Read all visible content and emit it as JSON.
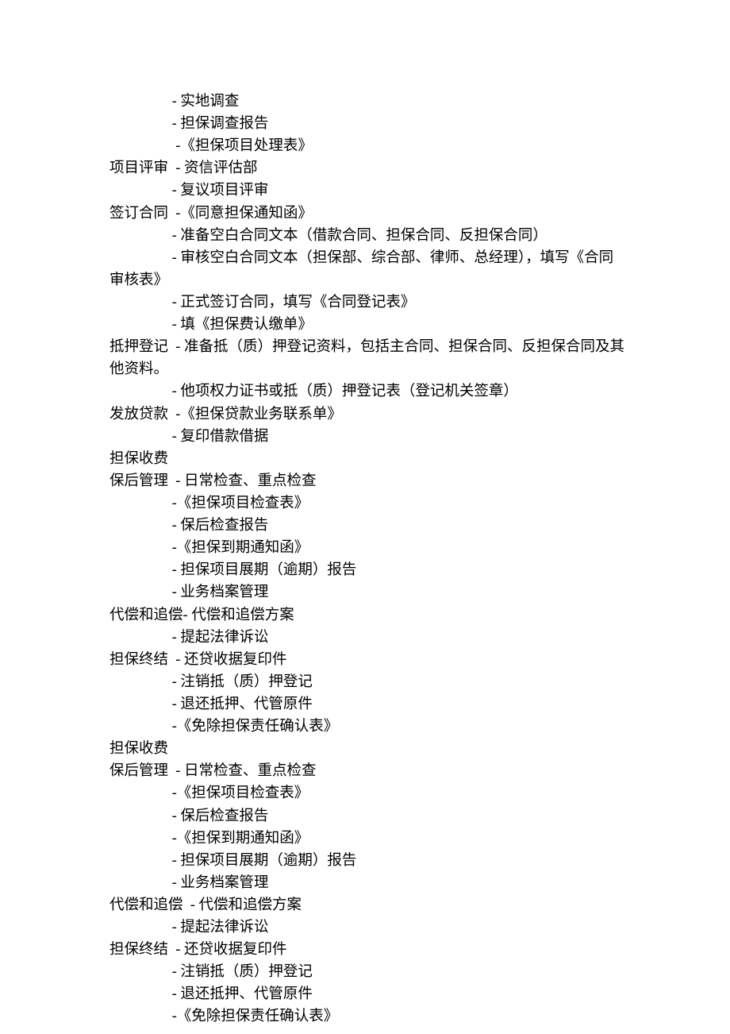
{
  "lines": [
    "                 - 实地调查",
    "                 - 担保调查报告",
    "                  -《担保项目处理表》",
    "项目评审  - 资信评估部",
    "                 - 复议项目评审",
    "签订合同  -《同意担保通知函》",
    "                 - 准备空白合同文本（借款合同、担保合同、反担保合同）",
    "                 - 审核空白合同文本（担保部、综合部、律师、总经理），填写《合同审核表》",
    "                 - 正式签订合同，填写《合同登记表》",
    "                 - 填《担保费认缴单》",
    "抵押登记  - 准备抵（质）押登记资料，包括主合同、担保合同、反担保合同及其他资料。",
    "                 - 他项权力证书或抵（质）押登记表（登记机关签章）",
    "发放贷款  -《担保贷款业务联系单》",
    "                 - 复印借款借据",
    "担保收费",
    "保后管理  - 日常检查、重点检查",
    "                 -《担保项目检查表》",
    "                 - 保后检查报告",
    "                 -《担保到期通知函》",
    "                 - 担保项目展期（逾期）报告",
    "                 - 业务档案管理",
    "代偿和追偿- 代偿和追偿方案",
    "                 - 提起法律诉讼",
    "担保终结  - 还贷收据复印件",
    "                 - 注销抵（质）押登记",
    "                 - 退还抵押、代管原件",
    "                 -《免除担保责任确认表》",
    "担保收费",
    "保后管理  - 日常检查、重点检查",
    "                 -《担保项目检查表》",
    "                 - 保后检查报告",
    "                 -《担保到期通知函》",
    "                 - 担保项目展期（逾期）报告",
    "                 - 业务档案管理",
    "代偿和追偿  - 代偿和追偿方案",
    "                 - 提起法律诉讼",
    "担保终结  - 还贷收据复印件",
    "                 - 注销抵（质）押登记",
    "                 - 退还抵押、代管原件",
    "                 -《免除担保责任确认表》"
  ]
}
